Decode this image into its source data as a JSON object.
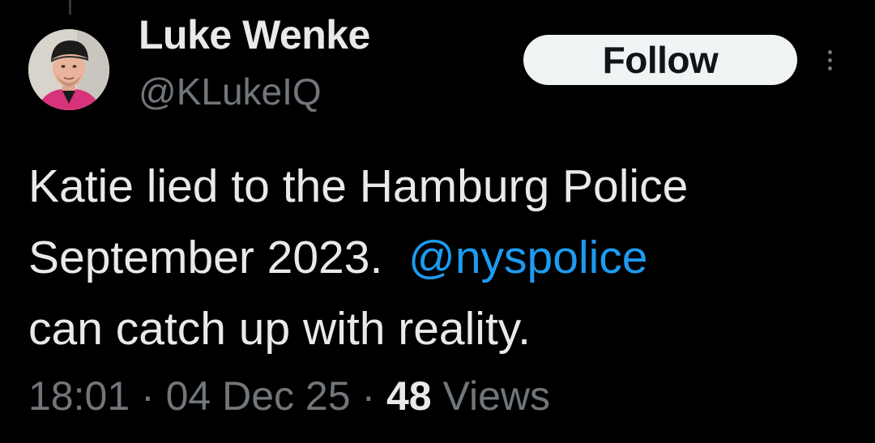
{
  "user": {
    "display_name": "Luke Wenke",
    "handle": "@KLukeIQ"
  },
  "follow_button": {
    "label": "Follow"
  },
  "tweet": {
    "line1": "Katie lied to the Hamburg Police",
    "line2_text": "September 2023.  ",
    "mention": "@nyspolice",
    "line3": "can catch up with reality."
  },
  "meta": {
    "time": "18:01",
    "separator": "·",
    "date": "04 Dec 25",
    "views_count": "48",
    "views_label": "Views"
  },
  "icons": {
    "more": "more-vertical-icon",
    "avatar": "avatar"
  },
  "colors": {
    "background": "#000000",
    "text_primary": "#e7e9ea",
    "text_secondary": "#71767b",
    "link": "#1d9bf0",
    "follow_bg": "#eff3f4"
  }
}
